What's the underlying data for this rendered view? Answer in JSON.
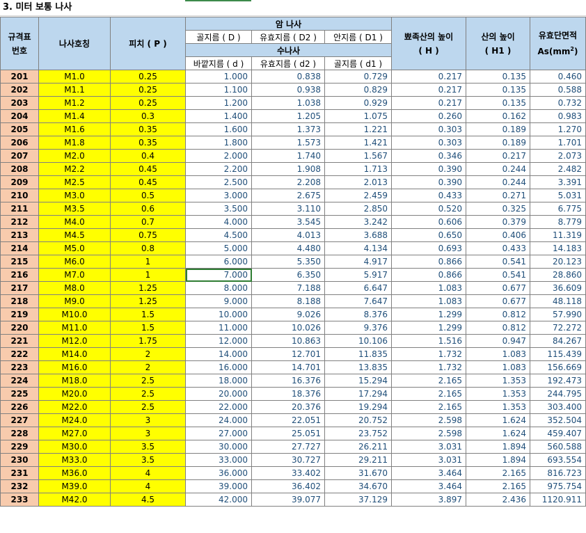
{
  "sheet": {
    "title": "3. 미터 보통 나사"
  },
  "headers": {
    "spec_no": [
      "규격표",
      "번호"
    ],
    "name": "나사호칭",
    "pitch": "피치 ( P )",
    "female": "암 나사",
    "female_major": "골지름 ( D )",
    "female_pitch": "유효지름 ( D2 )",
    "female_minor": "안지름 ( D1 )",
    "male": "수나사",
    "male_major": "바깥지름 ( d )",
    "male_pitch": "유효지름 ( d2 )",
    "male_minor": "골지름 ( d1 )",
    "peak_height": [
      "뾰족산의 높이",
      "( H )"
    ],
    "thread_height": [
      "산의 높이",
      "( H1 )"
    ],
    "area": [
      "유효단면적",
      "As(mm",
      "2",
      ")"
    ]
  },
  "rows": [
    [
      "201",
      "M1.0",
      "0.25",
      "1.000",
      "0.838",
      "0.729",
      "0.217",
      "0.135",
      "0.460"
    ],
    [
      "202",
      "M1.1",
      "0.25",
      "1.100",
      "0.938",
      "0.829",
      "0.217",
      "0.135",
      "0.588"
    ],
    [
      "203",
      "M1.2",
      "0.25",
      "1.200",
      "1.038",
      "0.929",
      "0.217",
      "0.135",
      "0.732"
    ],
    [
      "204",
      "M1.4",
      "0.3",
      "1.400",
      "1.205",
      "1.075",
      "0.260",
      "0.162",
      "0.983"
    ],
    [
      "205",
      "M1.6",
      "0.35",
      "1.600",
      "1.373",
      "1.221",
      "0.303",
      "0.189",
      "1.270"
    ],
    [
      "206",
      "M1.8",
      "0.35",
      "1.800",
      "1.573",
      "1.421",
      "0.303",
      "0.189",
      "1.701"
    ],
    [
      "207",
      "M2.0",
      "0.4",
      "2.000",
      "1.740",
      "1.567",
      "0.346",
      "0.217",
      "2.073"
    ],
    [
      "208",
      "M2.2",
      "0.45",
      "2.200",
      "1.908",
      "1.713",
      "0.390",
      "0.244",
      "2.482"
    ],
    [
      "209",
      "M2.5",
      "0.45",
      "2.500",
      "2.208",
      "2.013",
      "0.390",
      "0.244",
      "3.391"
    ],
    [
      "210",
      "M3.0",
      "0.5",
      "3.000",
      "2.675",
      "2.459",
      "0.433",
      "0.271",
      "5.031"
    ],
    [
      "211",
      "M3.5",
      "0.6",
      "3.500",
      "3.110",
      "2.850",
      "0.520",
      "0.325",
      "6.775"
    ],
    [
      "212",
      "M4.0",
      "0.7",
      "4.000",
      "3.545",
      "3.242",
      "0.606",
      "0.379",
      "8.779"
    ],
    [
      "213",
      "M4.5",
      "0.75",
      "4.500",
      "4.013",
      "3.688",
      "0.650",
      "0.406",
      "11.319"
    ],
    [
      "214",
      "M5.0",
      "0.8",
      "5.000",
      "4.480",
      "4.134",
      "0.693",
      "0.433",
      "14.183"
    ],
    [
      "215",
      "M6.0",
      "1",
      "6.000",
      "5.350",
      "4.917",
      "0.866",
      "0.541",
      "20.123"
    ],
    [
      "216",
      "M7.0",
      "1",
      "7.000",
      "6.350",
      "5.917",
      "0.866",
      "0.541",
      "28.860"
    ],
    [
      "217",
      "M8.0",
      "1.25",
      "8.000",
      "7.188",
      "6.647",
      "1.083",
      "0.677",
      "36.609"
    ],
    [
      "218",
      "M9.0",
      "1.25",
      "9.000",
      "8.188",
      "7.647",
      "1.083",
      "0.677",
      "48.118"
    ],
    [
      "219",
      "M10.0",
      "1.5",
      "10.000",
      "9.026",
      "8.376",
      "1.299",
      "0.812",
      "57.990"
    ],
    [
      "220",
      "M11.0",
      "1.5",
      "11.000",
      "10.026",
      "9.376",
      "1.299",
      "0.812",
      "72.272"
    ],
    [
      "221",
      "M12.0",
      "1.75",
      "12.000",
      "10.863",
      "10.106",
      "1.516",
      "0.947",
      "84.267"
    ],
    [
      "222",
      "M14.0",
      "2",
      "14.000",
      "12.701",
      "11.835",
      "1.732",
      "1.083",
      "115.439"
    ],
    [
      "223",
      "M16.0",
      "2",
      "16.000",
      "14.701",
      "13.835",
      "1.732",
      "1.083",
      "156.669"
    ],
    [
      "224",
      "M18.0",
      "2.5",
      "18.000",
      "16.376",
      "15.294",
      "2.165",
      "1.353",
      "192.473"
    ],
    [
      "225",
      "M20.0",
      "2.5",
      "20.000",
      "18.376",
      "17.294",
      "2.165",
      "1.353",
      "244.795"
    ],
    [
      "226",
      "M22.0",
      "2.5",
      "22.000",
      "20.376",
      "19.294",
      "2.165",
      "1.353",
      "303.400"
    ],
    [
      "227",
      "M24.0",
      "3",
      "24.000",
      "22.051",
      "20.752",
      "2.598",
      "1.624",
      "352.504"
    ],
    [
      "228",
      "M27.0",
      "3",
      "27.000",
      "25.051",
      "23.752",
      "2.598",
      "1.624",
      "459.407"
    ],
    [
      "229",
      "M30.0",
      "3.5",
      "30.000",
      "27.727",
      "26.211",
      "3.031",
      "1.894",
      "560.588"
    ],
    [
      "230",
      "M33.0",
      "3.5",
      "33.000",
      "30.727",
      "29.211",
      "3.031",
      "1.894",
      "693.554"
    ],
    [
      "231",
      "M36.0",
      "4",
      "36.000",
      "33.402",
      "31.670",
      "3.464",
      "2.165",
      "816.723"
    ],
    [
      "232",
      "M39.0",
      "4",
      "39.000",
      "36.402",
      "34.670",
      "3.464",
      "2.165",
      "975.754"
    ],
    [
      "233",
      "M42.0",
      "4.5",
      "42.000",
      "39.077",
      "37.129",
      "3.897",
      "2.436",
      "1120.911"
    ]
  ],
  "selected_row": "216",
  "colors": {
    "header_bg": "#bdd7ee",
    "spec_bg": "#f8cbad",
    "name_bg": "#ffff00",
    "number_text": "#1f4e79",
    "selection": "#2e7d32"
  }
}
